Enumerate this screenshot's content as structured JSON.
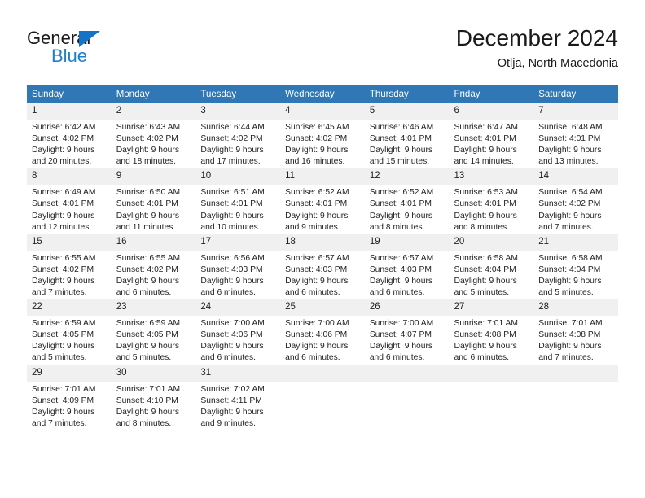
{
  "brand": {
    "name_dark": "General",
    "name_blue": "Blue",
    "accent_blue": "#1a7fd4",
    "triangle_blue": "#1473c6"
  },
  "header": {
    "title": "December 2024",
    "subtitle": "Otlja, North Macedonia",
    "header_bg": "#2f77b5",
    "daynum_bg": "#f0f0f0"
  },
  "weekday_headers": [
    "Sunday",
    "Monday",
    "Tuesday",
    "Wednesday",
    "Thursday",
    "Friday",
    "Saturday"
  ],
  "weeks": [
    [
      {
        "day": "1",
        "sunrise": "Sunrise: 6:42 AM",
        "sunset": "Sunset: 4:02 PM",
        "daylight1": "Daylight: 9 hours",
        "daylight2": "and 20 minutes."
      },
      {
        "day": "2",
        "sunrise": "Sunrise: 6:43 AM",
        "sunset": "Sunset: 4:02 PM",
        "daylight1": "Daylight: 9 hours",
        "daylight2": "and 18 minutes."
      },
      {
        "day": "3",
        "sunrise": "Sunrise: 6:44 AM",
        "sunset": "Sunset: 4:02 PM",
        "daylight1": "Daylight: 9 hours",
        "daylight2": "and 17 minutes."
      },
      {
        "day": "4",
        "sunrise": "Sunrise: 6:45 AM",
        "sunset": "Sunset: 4:02 PM",
        "daylight1": "Daylight: 9 hours",
        "daylight2": "and 16 minutes."
      },
      {
        "day": "5",
        "sunrise": "Sunrise: 6:46 AM",
        "sunset": "Sunset: 4:01 PM",
        "daylight1": "Daylight: 9 hours",
        "daylight2": "and 15 minutes."
      },
      {
        "day": "6",
        "sunrise": "Sunrise: 6:47 AM",
        "sunset": "Sunset: 4:01 PM",
        "daylight1": "Daylight: 9 hours",
        "daylight2": "and 14 minutes."
      },
      {
        "day": "7",
        "sunrise": "Sunrise: 6:48 AM",
        "sunset": "Sunset: 4:01 PM",
        "daylight1": "Daylight: 9 hours",
        "daylight2": "and 13 minutes."
      }
    ],
    [
      {
        "day": "8",
        "sunrise": "Sunrise: 6:49 AM",
        "sunset": "Sunset: 4:01 PM",
        "daylight1": "Daylight: 9 hours",
        "daylight2": "and 12 minutes."
      },
      {
        "day": "9",
        "sunrise": "Sunrise: 6:50 AM",
        "sunset": "Sunset: 4:01 PM",
        "daylight1": "Daylight: 9 hours",
        "daylight2": "and 11 minutes."
      },
      {
        "day": "10",
        "sunrise": "Sunrise: 6:51 AM",
        "sunset": "Sunset: 4:01 PM",
        "daylight1": "Daylight: 9 hours",
        "daylight2": "and 10 minutes."
      },
      {
        "day": "11",
        "sunrise": "Sunrise: 6:52 AM",
        "sunset": "Sunset: 4:01 PM",
        "daylight1": "Daylight: 9 hours",
        "daylight2": "and 9 minutes."
      },
      {
        "day": "12",
        "sunrise": "Sunrise: 6:52 AM",
        "sunset": "Sunset: 4:01 PM",
        "daylight1": "Daylight: 9 hours",
        "daylight2": "and 8 minutes."
      },
      {
        "day": "13",
        "sunrise": "Sunrise: 6:53 AM",
        "sunset": "Sunset: 4:01 PM",
        "daylight1": "Daylight: 9 hours",
        "daylight2": "and 8 minutes."
      },
      {
        "day": "14",
        "sunrise": "Sunrise: 6:54 AM",
        "sunset": "Sunset: 4:02 PM",
        "daylight1": "Daylight: 9 hours",
        "daylight2": "and 7 minutes."
      }
    ],
    [
      {
        "day": "15",
        "sunrise": "Sunrise: 6:55 AM",
        "sunset": "Sunset: 4:02 PM",
        "daylight1": "Daylight: 9 hours",
        "daylight2": "and 7 minutes."
      },
      {
        "day": "16",
        "sunrise": "Sunrise: 6:55 AM",
        "sunset": "Sunset: 4:02 PM",
        "daylight1": "Daylight: 9 hours",
        "daylight2": "and 6 minutes."
      },
      {
        "day": "17",
        "sunrise": "Sunrise: 6:56 AM",
        "sunset": "Sunset: 4:03 PM",
        "daylight1": "Daylight: 9 hours",
        "daylight2": "and 6 minutes."
      },
      {
        "day": "18",
        "sunrise": "Sunrise: 6:57 AM",
        "sunset": "Sunset: 4:03 PM",
        "daylight1": "Daylight: 9 hours",
        "daylight2": "and 6 minutes."
      },
      {
        "day": "19",
        "sunrise": "Sunrise: 6:57 AM",
        "sunset": "Sunset: 4:03 PM",
        "daylight1": "Daylight: 9 hours",
        "daylight2": "and 6 minutes."
      },
      {
        "day": "20",
        "sunrise": "Sunrise: 6:58 AM",
        "sunset": "Sunset: 4:04 PM",
        "daylight1": "Daylight: 9 hours",
        "daylight2": "and 5 minutes."
      },
      {
        "day": "21",
        "sunrise": "Sunrise: 6:58 AM",
        "sunset": "Sunset: 4:04 PM",
        "daylight1": "Daylight: 9 hours",
        "daylight2": "and 5 minutes."
      }
    ],
    [
      {
        "day": "22",
        "sunrise": "Sunrise: 6:59 AM",
        "sunset": "Sunset: 4:05 PM",
        "daylight1": "Daylight: 9 hours",
        "daylight2": "and 5 minutes."
      },
      {
        "day": "23",
        "sunrise": "Sunrise: 6:59 AM",
        "sunset": "Sunset: 4:05 PM",
        "daylight1": "Daylight: 9 hours",
        "daylight2": "and 5 minutes."
      },
      {
        "day": "24",
        "sunrise": "Sunrise: 7:00 AM",
        "sunset": "Sunset: 4:06 PM",
        "daylight1": "Daylight: 9 hours",
        "daylight2": "and 6 minutes."
      },
      {
        "day": "25",
        "sunrise": "Sunrise: 7:00 AM",
        "sunset": "Sunset: 4:06 PM",
        "daylight1": "Daylight: 9 hours",
        "daylight2": "and 6 minutes."
      },
      {
        "day": "26",
        "sunrise": "Sunrise: 7:00 AM",
        "sunset": "Sunset: 4:07 PM",
        "daylight1": "Daylight: 9 hours",
        "daylight2": "and 6 minutes."
      },
      {
        "day": "27",
        "sunrise": "Sunrise: 7:01 AM",
        "sunset": "Sunset: 4:08 PM",
        "daylight1": "Daylight: 9 hours",
        "daylight2": "and 6 minutes."
      },
      {
        "day": "28",
        "sunrise": "Sunrise: 7:01 AM",
        "sunset": "Sunset: 4:08 PM",
        "daylight1": "Daylight: 9 hours",
        "daylight2": "and 7 minutes."
      }
    ],
    [
      {
        "day": "29",
        "sunrise": "Sunrise: 7:01 AM",
        "sunset": "Sunset: 4:09 PM",
        "daylight1": "Daylight: 9 hours",
        "daylight2": "and 7 minutes."
      },
      {
        "day": "30",
        "sunrise": "Sunrise: 7:01 AM",
        "sunset": "Sunset: 4:10 PM",
        "daylight1": "Daylight: 9 hours",
        "daylight2": "and 8 minutes."
      },
      {
        "day": "31",
        "sunrise": "Sunrise: 7:02 AM",
        "sunset": "Sunset: 4:11 PM",
        "daylight1": "Daylight: 9 hours",
        "daylight2": "and 9 minutes."
      },
      {
        "day": "",
        "sunrise": "",
        "sunset": "",
        "daylight1": "",
        "daylight2": ""
      },
      {
        "day": "",
        "sunrise": "",
        "sunset": "",
        "daylight1": "",
        "daylight2": ""
      },
      {
        "day": "",
        "sunrise": "",
        "sunset": "",
        "daylight1": "",
        "daylight2": ""
      },
      {
        "day": "",
        "sunrise": "",
        "sunset": "",
        "daylight1": "",
        "daylight2": ""
      }
    ]
  ]
}
